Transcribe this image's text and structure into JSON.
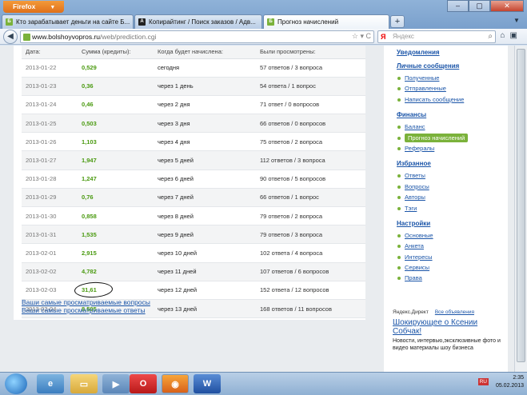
{
  "browser": {
    "menu_label": "Firefox",
    "tabs": [
      {
        "label": "Кто зарабатывает деньги на сайте Б...",
        "favicon": "green-b-icon"
      },
      {
        "label": "Копирайтинг / Поиск заказов / Адв...",
        "favicon": "black-a-icon"
      },
      {
        "label": "Прогноз начислений",
        "favicon": "green-b-icon",
        "active": true
      }
    ],
    "url_host": "www.bolshoyvopros.ru",
    "url_path": "/web/prediction.cgi",
    "search_placeholder": "Яндекс"
  },
  "table": {
    "headers": [
      "Дата:",
      "Сумма (кредиты):",
      "Когда будет начислена:",
      "Были просмотрены:"
    ],
    "rows": [
      {
        "date": "2013-01-22",
        "sum": "0,529",
        "when": "сегодня",
        "viewed": "57 ответов / 3 вопроса"
      },
      {
        "date": "2013-01-23",
        "sum": "0,36",
        "when": "через 1 день",
        "viewed": "54 ответа / 1 вопрос"
      },
      {
        "date": "2013-01-24",
        "sum": "0,46",
        "when": "через 2 дня",
        "viewed": "71 ответ / 0 вопросов"
      },
      {
        "date": "2013-01-25",
        "sum": "0,503",
        "when": "через 3 дня",
        "viewed": "66 ответов / 0 вопросов"
      },
      {
        "date": "2013-01-26",
        "sum": "1,103",
        "when": "через 4 дня",
        "viewed": "75 ответов / 2 вопроса"
      },
      {
        "date": "2013-01-27",
        "sum": "1,947",
        "when": "через 5 дней",
        "viewed": "112 ответов / 3 вопроса"
      },
      {
        "date": "2013-01-28",
        "sum": "1,247",
        "when": "через 6 дней",
        "viewed": "90 ответов / 5 вопросов"
      },
      {
        "date": "2013-01-29",
        "sum": "0,76",
        "when": "через 7 дней",
        "viewed": "66 ответов / 1 вопрос"
      },
      {
        "date": "2013-01-30",
        "sum": "0,858",
        "when": "через 8 дней",
        "viewed": "79 ответов / 2 вопроса"
      },
      {
        "date": "2013-01-31",
        "sum": "1,535",
        "when": "через 9 дней",
        "viewed": "79 ответов / 3 вопроса"
      },
      {
        "date": "2013-02-01",
        "sum": "2,915",
        "when": "через 10 дней",
        "viewed": "102 ответа / 4 вопроса"
      },
      {
        "date": "2013-02-02",
        "sum": "4,782",
        "when": "через 11 дней",
        "viewed": "107 ответов / 6 вопросов"
      },
      {
        "date": "2013-02-03",
        "sum": "31,61",
        "when": "через 12 дней",
        "viewed": "152 ответа / 12 вопросов",
        "circled": true
      },
      {
        "date": "2013-02-04",
        "sum": "8,595",
        "when": "через 13 дней",
        "viewed": "168 ответов / 11 вопросов"
      }
    ]
  },
  "links": {
    "popular_questions": "Ваши самые просматриваемые вопросы",
    "popular_answers": "Ваши самые просматриваемые ответы"
  },
  "sidebar": {
    "notifications": "Уведомления",
    "messages": {
      "title": "Личные сообщения",
      "items": [
        "Полученные",
        "Отправленные",
        "Написать сообщение"
      ]
    },
    "finance": {
      "title": "Финансы",
      "items": [
        "Баланс",
        "Прогноз начислений",
        "Рефералы"
      ],
      "active": "Прогноз начислений"
    },
    "favorites": {
      "title": "Избранное",
      "items": [
        "Ответы",
        "Вопросы",
        "Авторы",
        "Тэги"
      ]
    },
    "settings": {
      "title": "Настройки",
      "items": [
        "Основные",
        "Анкета",
        "Интересы",
        "Сервисы",
        "Права"
      ]
    }
  },
  "ad": {
    "source": "Яндекс.Директ",
    "all_ads": "Все объявления",
    "title": "Шокирующее о Ксении Собчак!",
    "text": "Новости, интервью,эксклюзивные фото и видео материалы шоу бизнеса"
  },
  "taskbar": {
    "lang": "RU",
    "time": "2:35",
    "date": "05.02.2013"
  },
  "colors": {
    "accent_green": "#7bb23b",
    "link_blue": "#1b55a8",
    "sum_green": "#4a9a10"
  }
}
